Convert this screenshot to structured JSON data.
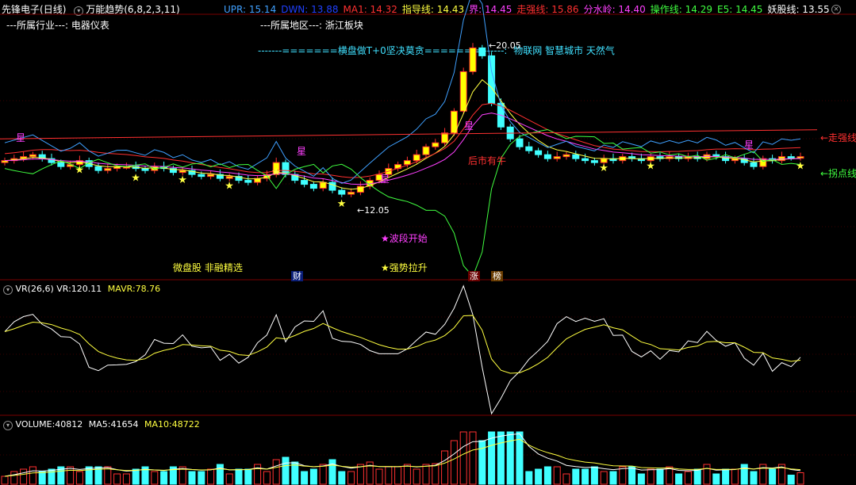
{
  "header": {
    "stock_name": "先锋电子",
    "period": "(日线)",
    "indicator": "万能趋势(6,8,2,3,11)",
    "values": [
      {
        "label": "UPR:",
        "value": "15.14",
        "color": "#3fa0ff"
      },
      {
        "label": "DWN:",
        "value": "13.88",
        "color": "#2040ff"
      },
      {
        "label": "MA1:",
        "value": "14.32",
        "color": "#ff3030"
      },
      {
        "label": "指导线:",
        "value": "14.43",
        "color": "#ffff40"
      },
      {
        "label": "界:",
        "value": "14.45",
        "color": "#ff40ff"
      },
      {
        "label": "走强线:",
        "value": "15.86",
        "color": "#ff3030"
      },
      {
        "label": "分水岭:",
        "value": "14.40",
        "color": "#ff40ff"
      },
      {
        "label": "操作线:",
        "value": "14.29",
        "color": "#40ff40"
      },
      {
        "label": "E5:",
        "value": "14.45",
        "color": "#40ff40"
      },
      {
        "label": "妖股线:",
        "value": "13.55",
        "color": "#ffffff"
      }
    ],
    "close_icon": "close-circle-icon"
  },
  "info": {
    "industry_label": "---所属行业---:",
    "industry_value": "电器仪表",
    "region_label": "---所属地区---:",
    "region_value": "浙江板块",
    "banner": "-------=======横盘做T+0坚决莫贪=======-------:",
    "concepts": "物联网 智慧城市 天然气"
  },
  "annotations": {
    "high_price": "20.05",
    "low_price": "12.05",
    "low_arrow": "←12.05",
    "high_arrow": "←20.05",
    "after_bull": "后市有牛",
    "strong_line": "←走强线",
    "turn_line": "←拐点线",
    "wave_start": "★波段开始",
    "strong_rise": "★强势拉升",
    "micro_cap": "微盘股 非融精选",
    "tag_cai": "财",
    "tag_zhang": "涨",
    "tag_bang": "榜",
    "star_marker": "★",
    "xing_marker": "星",
    "arrow_marker": "↑"
  },
  "vr_panel": {
    "title": "VR(26,6)",
    "vr_label": "VR:",
    "vr_value": "120.11",
    "mavr_label": "MAVR:",
    "mavr_value": "78.76"
  },
  "volume_panel": {
    "title": "VOLUME:",
    "volume_value": "40812",
    "ma5_label": "MA5:",
    "ma5_value": "41654",
    "ma10_label": "MA10:",
    "ma10_value": "48722"
  },
  "colors": {
    "up": "#ffff00",
    "up_edge": "#ff3030",
    "down": "#40ffff",
    "upr": "#3fa0ff",
    "ma_red": "#ff3030",
    "guide": "#ffff40",
    "boundary": "#ff40ff",
    "operate": "#40ff40",
    "separator": "#7a0000"
  },
  "chart_data": {
    "type": "line",
    "price_range": [
      11.0,
      21.5
    ],
    "closes": [
      14.3,
      14.4,
      14.5,
      14.6,
      14.4,
      14.2,
      14.0,
      14.1,
      14.3,
      14.0,
      13.8,
      13.9,
      14.0,
      14.0,
      13.9,
      13.8,
      14.0,
      13.9,
      13.7,
      13.8,
      13.6,
      13.5,
      13.6,
      13.4,
      13.5,
      13.3,
      13.2,
      13.4,
      13.6,
      14.2,
      13.6,
      13.3,
      13.1,
      12.9,
      13.2,
      12.8,
      12.6,
      12.7,
      13.0,
      13.3,
      13.6,
      13.9,
      14.1,
      14.3,
      14.6,
      15.0,
      15.2,
      15.7,
      16.8,
      18.8,
      20.0,
      19.6,
      17.2,
      16.0,
      15.4,
      15.0,
      14.8,
      14.6,
      14.4,
      14.5,
      14.6,
      14.4,
      14.3,
      14.2,
      14.4,
      14.3,
      14.5,
      14.4,
      14.3,
      14.5,
      14.4,
      14.5,
      14.4,
      14.5,
      14.4,
      14.6,
      14.5,
      14.3,
      14.4,
      14.2,
      14.0,
      14.4,
      14.3,
      14.5,
      14.45,
      14.5
    ]
  }
}
